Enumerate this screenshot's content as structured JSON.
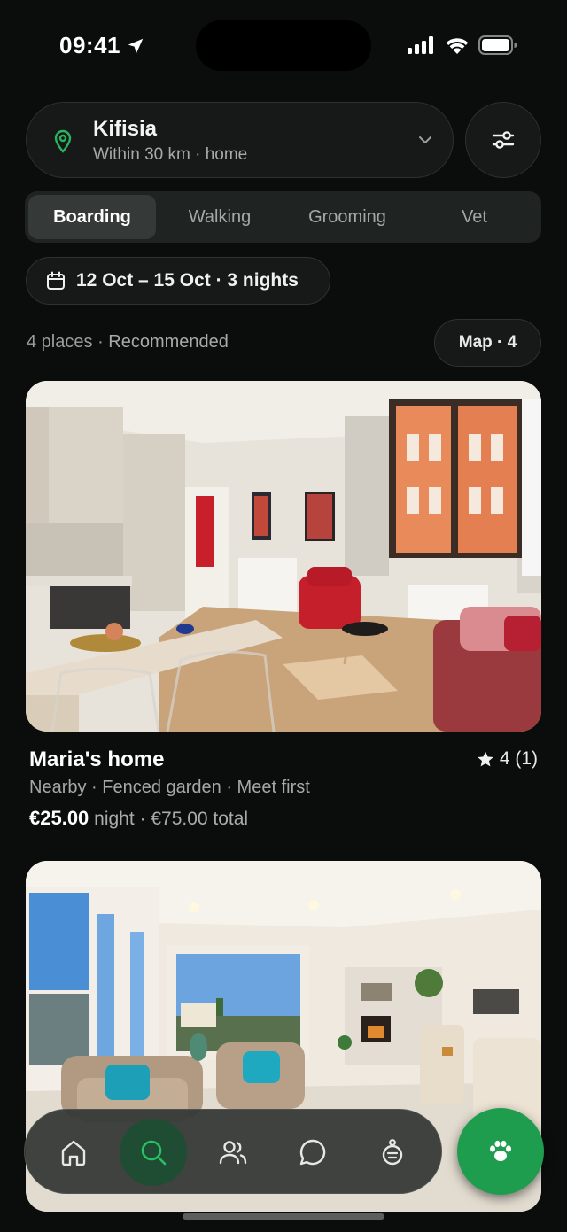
{
  "status": {
    "time": "09:41"
  },
  "location": {
    "title": "Kifisia",
    "subtitle": "Within 30 km · home"
  },
  "segments": [
    {
      "label": "Boarding",
      "active": true
    },
    {
      "label": "Walking",
      "active": false
    },
    {
      "label": "Grooming",
      "active": false
    },
    {
      "label": "Vet",
      "active": false
    }
  ],
  "dates": {
    "label": "12 Oct – 15 Oct · 3 nights"
  },
  "results": {
    "count": "4 places",
    "sort": "Recommended",
    "map_label": "Map · 4"
  },
  "listings": [
    {
      "title": "Maria's home",
      "rating": "4 (1)",
      "tags": "Nearby · Fenced garden · Meet first",
      "price": "€25.00",
      "price_unit": "night · €75.00 total"
    }
  ],
  "tabs": [
    {
      "name": "home-icon",
      "active": false
    },
    {
      "name": "search-icon",
      "active": true
    },
    {
      "name": "people-icon",
      "active": false
    },
    {
      "name": "chat-icon",
      "active": false
    },
    {
      "name": "pet-tag-icon",
      "active": false
    }
  ],
  "colors": {
    "accent": "#1f9d4e",
    "background": "#0b0c0c"
  }
}
